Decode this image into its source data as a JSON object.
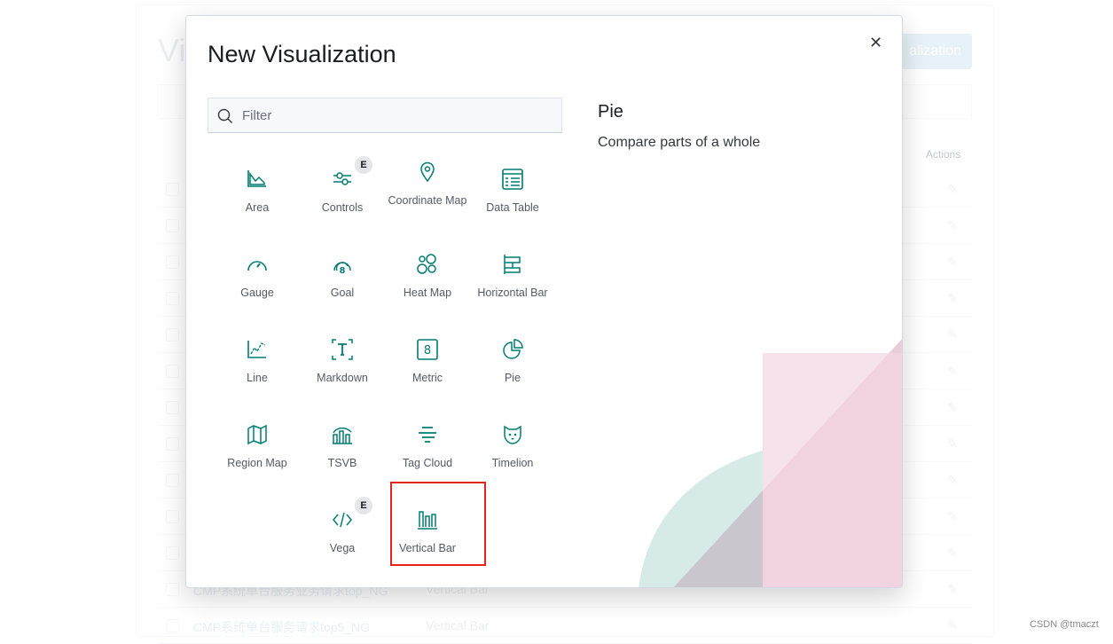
{
  "background": {
    "title_fragment": "Vi",
    "create_button_fragment": "alization",
    "actions_header": "Actions",
    "rows": [
      {
        "name": "CMP系统单台服务业务请求top_NG",
        "type": "Vertical Bar"
      },
      {
        "name": "CMP系统单台服务请求top5_NG",
        "type": "Vertical Bar"
      }
    ]
  },
  "modal": {
    "title": "New Visualization",
    "filter_placeholder": "Filter",
    "items": [
      {
        "label": "Area",
        "icon": "area-chart-icon"
      },
      {
        "label": "Controls",
        "icon": "controls-icon",
        "badge": "E"
      },
      {
        "label": "Coordinate Map",
        "icon": "map-pin-icon"
      },
      {
        "label": "Data Table",
        "icon": "table-icon"
      },
      {
        "label": "Gauge",
        "icon": "gauge-icon"
      },
      {
        "label": "Goal",
        "icon": "goal-icon"
      },
      {
        "label": "Heat Map",
        "icon": "heatmap-icon"
      },
      {
        "label": "Horizontal Bar",
        "icon": "horizontal-bar-icon"
      },
      {
        "label": "Line",
        "icon": "line-chart-icon"
      },
      {
        "label": "Markdown",
        "icon": "markdown-icon"
      },
      {
        "label": "Metric",
        "icon": "metric-icon"
      },
      {
        "label": "Pie",
        "icon": "pie-icon"
      },
      {
        "label": "Region Map",
        "icon": "region-map-icon"
      },
      {
        "label": "TSVB",
        "icon": "tsvb-icon"
      },
      {
        "label": "Tag Cloud",
        "icon": "tag-cloud-icon"
      },
      {
        "label": "Timelion",
        "icon": "timelion-icon"
      },
      {
        "label": "Vega",
        "icon": "code-icon",
        "badge": "E"
      },
      {
        "label": "Vertical Bar",
        "icon": "vertical-bar-icon"
      }
    ],
    "detail": {
      "title": "Pie",
      "description": "Compare parts of a whole"
    },
    "highlighted": "Vertical Bar"
  },
  "colors": {
    "accent": "#017d73",
    "highlight_box": "#e8231c"
  },
  "watermark": "CSDN @tmaczt"
}
